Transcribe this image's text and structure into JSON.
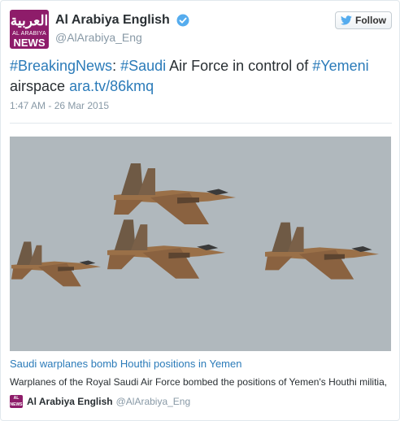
{
  "account": {
    "logo_arabic": "العربية",
    "logo_line1": "AL ARABIYA",
    "logo_line2": "NEWS",
    "display_name": "Al Arabiya English",
    "handle": "@AlArabiya_Eng",
    "verified": true
  },
  "follow_button": {
    "label": "Follow",
    "icon": "twitter-bird-icon"
  },
  "tweet": {
    "tag1": "#BreakingNews",
    "sep1": ":",
    "tag2": "#Saudi",
    "text1": " Air Force in control of ",
    "tag3": "#Yemeni",
    "text2": "airspace",
    "link": "ara.tv/86kmq",
    "timestamp": "1:47 AM - 26 Mar 2015"
  },
  "card": {
    "image_icon": "fighter-jets-photo",
    "title": "Saudi warplanes bomb Houthi positions in Yemen",
    "description": "Warplanes of the Royal Saudi Air Force bombed the positions of Yemen's Houthi militia,",
    "source_name": "Al Arabiya English",
    "source_handle": "@AlArabiya_Eng"
  },
  "colors": {
    "link": "#2b7bb9",
    "brand": "#8e1c6a",
    "muted": "#8899a6",
    "sky": "#aeb6bb"
  }
}
